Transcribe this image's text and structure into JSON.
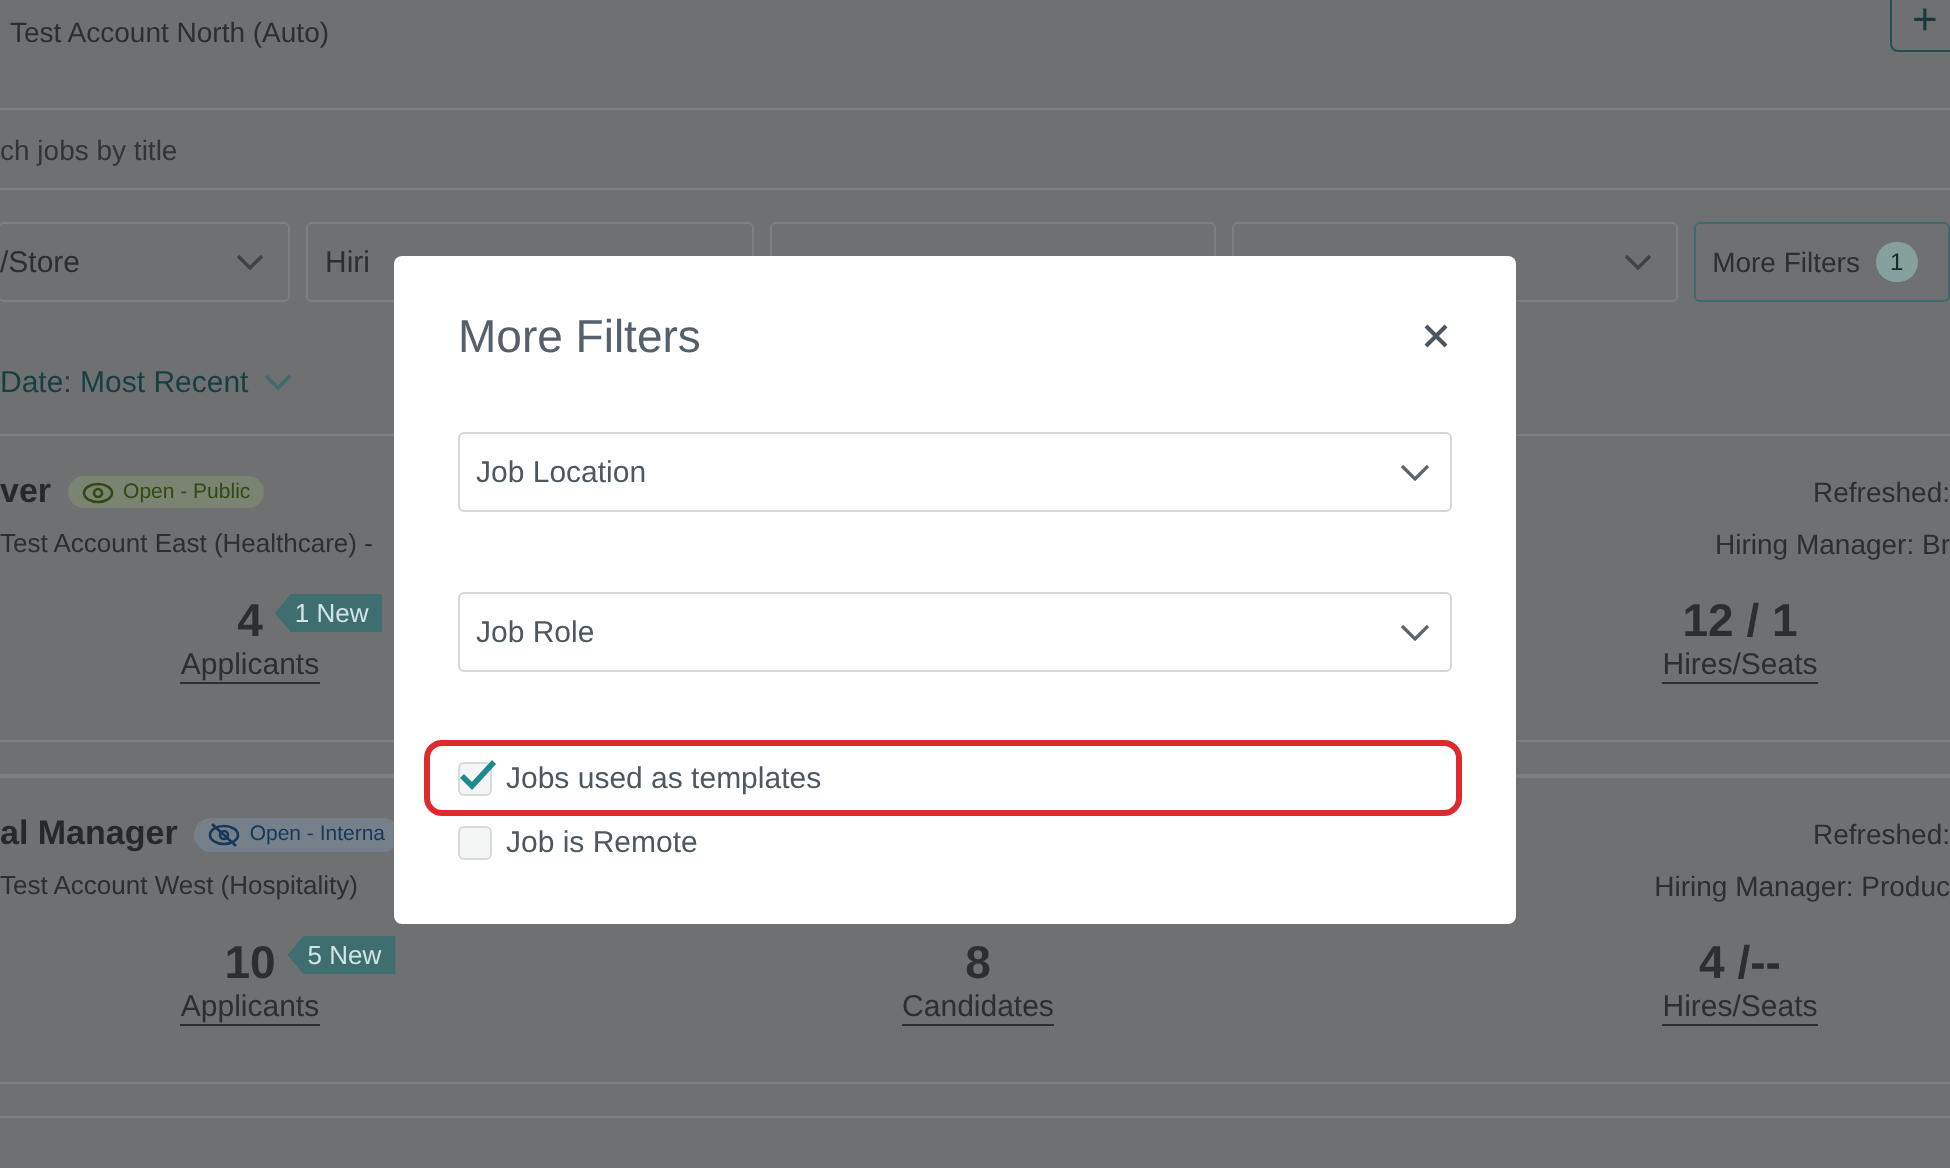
{
  "account": {
    "name": "Test Account North (Auto)",
    "add_button": "+"
  },
  "search": {
    "placeholder": "ch jobs by title"
  },
  "filters": [
    {
      "kind": "select",
      "label": "/Store"
    },
    {
      "kind": "field",
      "label": "Hiri"
    },
    {
      "kind": "field"
    },
    {
      "kind": "select"
    }
  ],
  "more_filters": {
    "label": "More Filters",
    "count": "1"
  },
  "sort": {
    "label": "Date: Most Recent"
  },
  "jobs": [
    {
      "title": "ver",
      "status": {
        "label": "Open - Public",
        "kind": "public"
      },
      "account": "Test Account East (Healthcare) -",
      "refreshed": "Refreshed:",
      "hiring_manager": "Hiring Manager: Br",
      "stats": {
        "applicants": {
          "value": "4",
          "new_tag": "1 New",
          "label": "Applicants"
        },
        "hires": {
          "value": "12 / 1",
          "label": "Hires/Seats"
        }
      }
    },
    {
      "title": "al Manager",
      "status": {
        "label": "Open - Interna",
        "kind": "internal"
      },
      "account": "Test Account West (Hospitality)",
      "refreshed": "Refreshed:",
      "hiring_manager": "Hiring Manager: Produc",
      "stats": {
        "applicants": {
          "value": "10",
          "new_tag": "5 New",
          "label": "Applicants"
        },
        "candidates": {
          "value": "8",
          "label": "Candidates"
        },
        "hires": {
          "value": "4 /--",
          "label": "Hires/Seats"
        }
      }
    }
  ],
  "modal": {
    "title": "More Filters",
    "selects": [
      {
        "placeholder": "Job Location"
      },
      {
        "placeholder": "Job Role"
      }
    ],
    "options": [
      {
        "label": "Jobs used as templates",
        "checked": true,
        "highlighted": true
      },
      {
        "label": "Job is Remote",
        "checked": false,
        "highlighted": false
      }
    ]
  }
}
